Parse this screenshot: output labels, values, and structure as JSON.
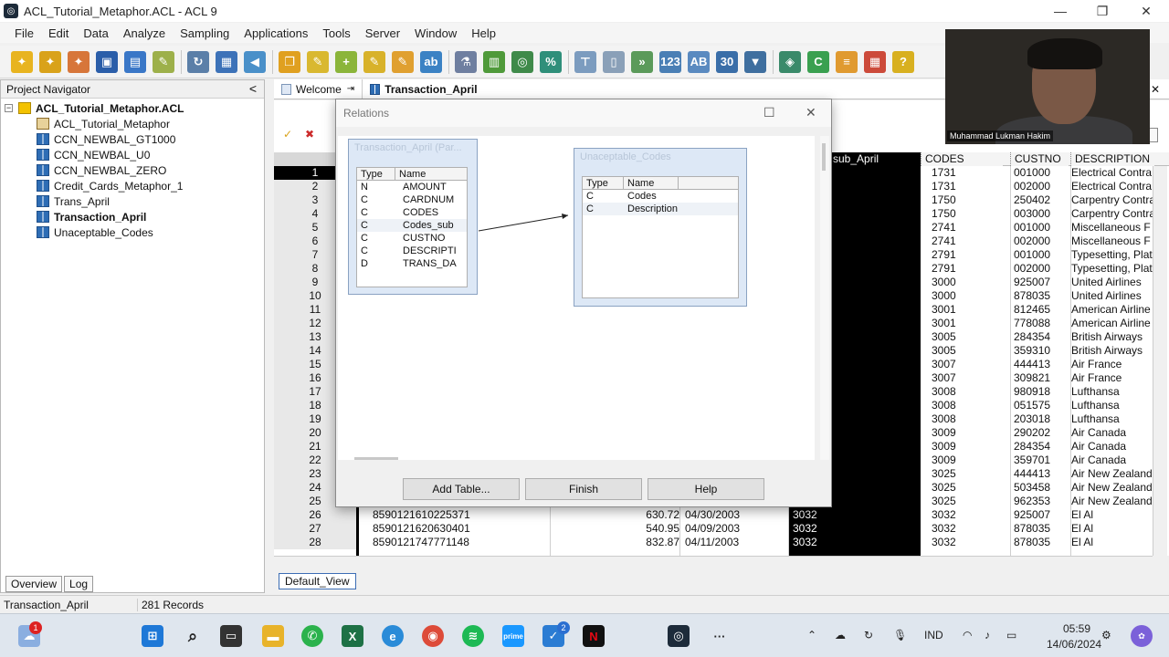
{
  "window": {
    "title": "ACL_Tutorial_Metaphor.ACL - ACL 9",
    "minimize": "—",
    "restore": "❐",
    "close": "✕"
  },
  "menu": [
    "File",
    "Edit",
    "Data",
    "Analyze",
    "Sampling",
    "Applications",
    "Tools",
    "Server",
    "Window",
    "Help"
  ],
  "navigator": {
    "title": "Project Navigator",
    "collapse": "<",
    "project": "ACL_Tutorial_Metaphor.ACL",
    "items": [
      {
        "label": "ACL_Tutorial_Metaphor",
        "icon": "script-icon"
      },
      {
        "label": "CCN_NEWBAL_GT1000",
        "icon": "table-icon"
      },
      {
        "label": "CCN_NEWBAL_U0",
        "icon": "table-icon"
      },
      {
        "label": "CCN_NEWBAL_ZERO",
        "icon": "table-icon"
      },
      {
        "label": "Credit_Cards_Metaphor_1",
        "icon": "table-icon"
      },
      {
        "label": "Trans_April",
        "icon": "table-icon"
      },
      {
        "label": "Transaction_April",
        "icon": "table-icon"
      },
      {
        "label": "Unaceptable_Codes",
        "icon": "table-icon"
      }
    ],
    "tabs": [
      "Overview",
      "Log"
    ]
  },
  "tabs": {
    "welcome": "Welcome",
    "active": "Transaction_April"
  },
  "grid": {
    "columns": [
      "sub_April",
      "CODES",
      "CUSTNO",
      "DESCRIPTION"
    ],
    "row_numbers": [
      "1",
      "2",
      "3",
      "4",
      "5",
      "6",
      "7",
      "8",
      "9",
      "10",
      "11",
      "12",
      "13",
      "14",
      "15",
      "16",
      "17",
      "18",
      "19",
      "20",
      "21",
      "22",
      "23",
      "24",
      "25",
      "26",
      "27",
      "28"
    ],
    "rows": [
      {
        "codes": "1731",
        "custno": "001000",
        "desc": "Electrical Contra"
      },
      {
        "codes": "1731",
        "custno": "002000",
        "desc": "Electrical Contra"
      },
      {
        "codes": "1750",
        "custno": "250402",
        "desc": "Carpentry Contra"
      },
      {
        "codes": "1750",
        "custno": "003000",
        "desc": "Carpentry Contra"
      },
      {
        "codes": "2741",
        "custno": "001000",
        "desc": "Miscellaneous F"
      },
      {
        "codes": "2741",
        "custno": "002000",
        "desc": "Miscellaneous F"
      },
      {
        "codes": "2791",
        "custno": "001000",
        "desc": "Typesetting, Plat"
      },
      {
        "codes": "2791",
        "custno": "002000",
        "desc": "Typesetting, Plat"
      },
      {
        "codes": "3000",
        "custno": "925007",
        "desc": "United Airlines"
      },
      {
        "codes": "3000",
        "custno": "878035",
        "desc": "United Airlines"
      },
      {
        "codes": "3001",
        "custno": "812465",
        "desc": "American Airline"
      },
      {
        "codes": "3001",
        "custno": "778088",
        "desc": "American Airline"
      },
      {
        "codes": "3005",
        "custno": "284354",
        "desc": "British Airways"
      },
      {
        "codes": "3005",
        "custno": "359310",
        "desc": "British Airways"
      },
      {
        "codes": "3007",
        "custno": "444413",
        "desc": "Air France"
      },
      {
        "codes": "3007",
        "custno": "309821",
        "desc": "Air France"
      },
      {
        "codes": "3008",
        "custno": "980918",
        "desc": "Lufthansa"
      },
      {
        "codes": "3008",
        "custno": "051575",
        "desc": "Lufthansa"
      },
      {
        "codes": "3008",
        "custno": "203018",
        "desc": "Lufthansa"
      },
      {
        "codes": "3009",
        "custno": "290202",
        "desc": "Air Canada"
      },
      {
        "codes": "3009",
        "custno": "284354",
        "desc": "Air Canada"
      },
      {
        "codes": "3009",
        "custno": "359701",
        "desc": "Air Canada"
      },
      {
        "codes": "3025",
        "custno": "444413",
        "desc": "Air New Zealand"
      },
      {
        "codes": "3025",
        "custno": "503458",
        "desc": "Air New Zealand"
      },
      {
        "codes": "3025",
        "custno": "962353",
        "desc": "Air New Zealand"
      },
      {
        "card": "8590121610225371",
        "amount": "630.72",
        "date": "04/30/2003",
        "sub": "3032",
        "codes": "3032",
        "custno": "925007",
        "desc": "El Al"
      },
      {
        "card": "8590121620630401",
        "amount": "540.95",
        "date": "04/09/2003",
        "sub": "3032",
        "codes": "3032",
        "custno": "878035",
        "desc": "El Al"
      },
      {
        "card": "8590121747771148",
        "amount": "832.87",
        "date": "04/11/2003",
        "sub": "3032",
        "codes": "3032",
        "custno": "878035",
        "desc": "El Al"
      }
    ],
    "view_tab": "Default_View"
  },
  "dialog": {
    "title": "Relations",
    "left_table": {
      "title": "Transaction_April (Par...",
      "col_type": "Type",
      "col_name": "Name",
      "fields": [
        {
          "type": "N",
          "name": "AMOUNT"
        },
        {
          "type": "C",
          "name": "CARDNUM"
        },
        {
          "type": "C",
          "name": "CODES"
        },
        {
          "type": "C",
          "name": "Codes_sub"
        },
        {
          "type": "C",
          "name": "CUSTNO"
        },
        {
          "type": "C",
          "name": "DESCRIPTI"
        },
        {
          "type": "D",
          "name": "TRANS_DA"
        }
      ]
    },
    "right_table": {
      "title": "Unaceptable_Codes",
      "col_type": "Type",
      "col_name": "Name",
      "fields": [
        {
          "type": "C",
          "name": "Codes"
        },
        {
          "type": "C",
          "name": "Description"
        }
      ]
    },
    "buttons": {
      "add": "Add Table...",
      "finish": "Finish",
      "help": "Help"
    }
  },
  "status": {
    "table": "Transaction_April",
    "records": "281 Records"
  },
  "webcam": {
    "name": "Muhammad Lukman Hakim"
  },
  "taskbar": {
    "notif_badge": "1",
    "badge2": "2",
    "lang": "IND",
    "time": "05:59",
    "date": "14/06/2024"
  },
  "colors": {
    "accent": "#2e6db5",
    "black_col": "#000000"
  }
}
